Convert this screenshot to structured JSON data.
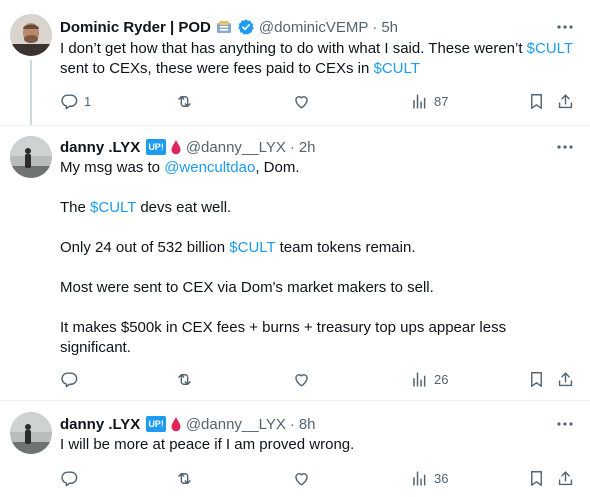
{
  "tweets": [
    {
      "author_name": "Dominic Ryder | POD",
      "handle": "@dominicVEMP",
      "separator": "·",
      "time": "5h",
      "verified": true,
      "body_parts": [
        {
          "text": "I don’t get how that has anything to do with what I said. These weren’t "
        },
        {
          "text": "$CULT",
          "link": true
        },
        {
          "text": " sent to CEXs, these were fees paid to CEXs in "
        },
        {
          "text": "$CULT",
          "link": true
        }
      ],
      "actions": {
        "replies": "1",
        "reposts": "",
        "likes": "",
        "views": "87"
      }
    },
    {
      "author_name": "danny .LYX",
      "handle": "@danny__LYX",
      "separator": "·",
      "time": "2h",
      "badge_text": "UP!",
      "paragraphs": [
        [
          {
            "text": "My msg was to "
          },
          {
            "text": "@wencultdao",
            "link": true
          },
          {
            "text": ", Dom."
          }
        ],
        [
          {
            "text": "The "
          },
          {
            "text": "$CULT",
            "link": true
          },
          {
            "text": " devs eat well."
          }
        ],
        [
          {
            "text": "Only 24 out of 532 billion "
          },
          {
            "text": "$CULT",
            "link": true
          },
          {
            "text": " team tokens remain."
          }
        ],
        [
          {
            "text": "Most were sent to CEX via Dom's market makers to sell."
          }
        ],
        [
          {
            "text": "It makes $500k in CEX fees + burns + treasury top ups appear less significant."
          }
        ]
      ],
      "actions": {
        "replies": "",
        "reposts": "",
        "likes": "",
        "views": "26"
      }
    },
    {
      "author_name": "danny .LYX",
      "handle": "@danny__LYX",
      "separator": "·",
      "time": "8h",
      "badge_text": "UP!",
      "body": "I will be more at peace if I am proved wrong.",
      "actions": {
        "replies": "",
        "reposts": "",
        "likes": "",
        "views": "36"
      }
    }
  ],
  "icons": {
    "verified": "verified-badge-icon",
    "more": "more-icon",
    "reply": "reply-icon",
    "repost": "repost-icon",
    "like": "like-icon",
    "views": "views-icon",
    "bookmark": "bookmark-icon",
    "share": "share-icon"
  },
  "colors": {
    "link": "#1d9bf0",
    "verified": "#1d9bf0",
    "up_badge": "#1d9bf0",
    "drop": "#e0245e",
    "muted": "#536471"
  }
}
